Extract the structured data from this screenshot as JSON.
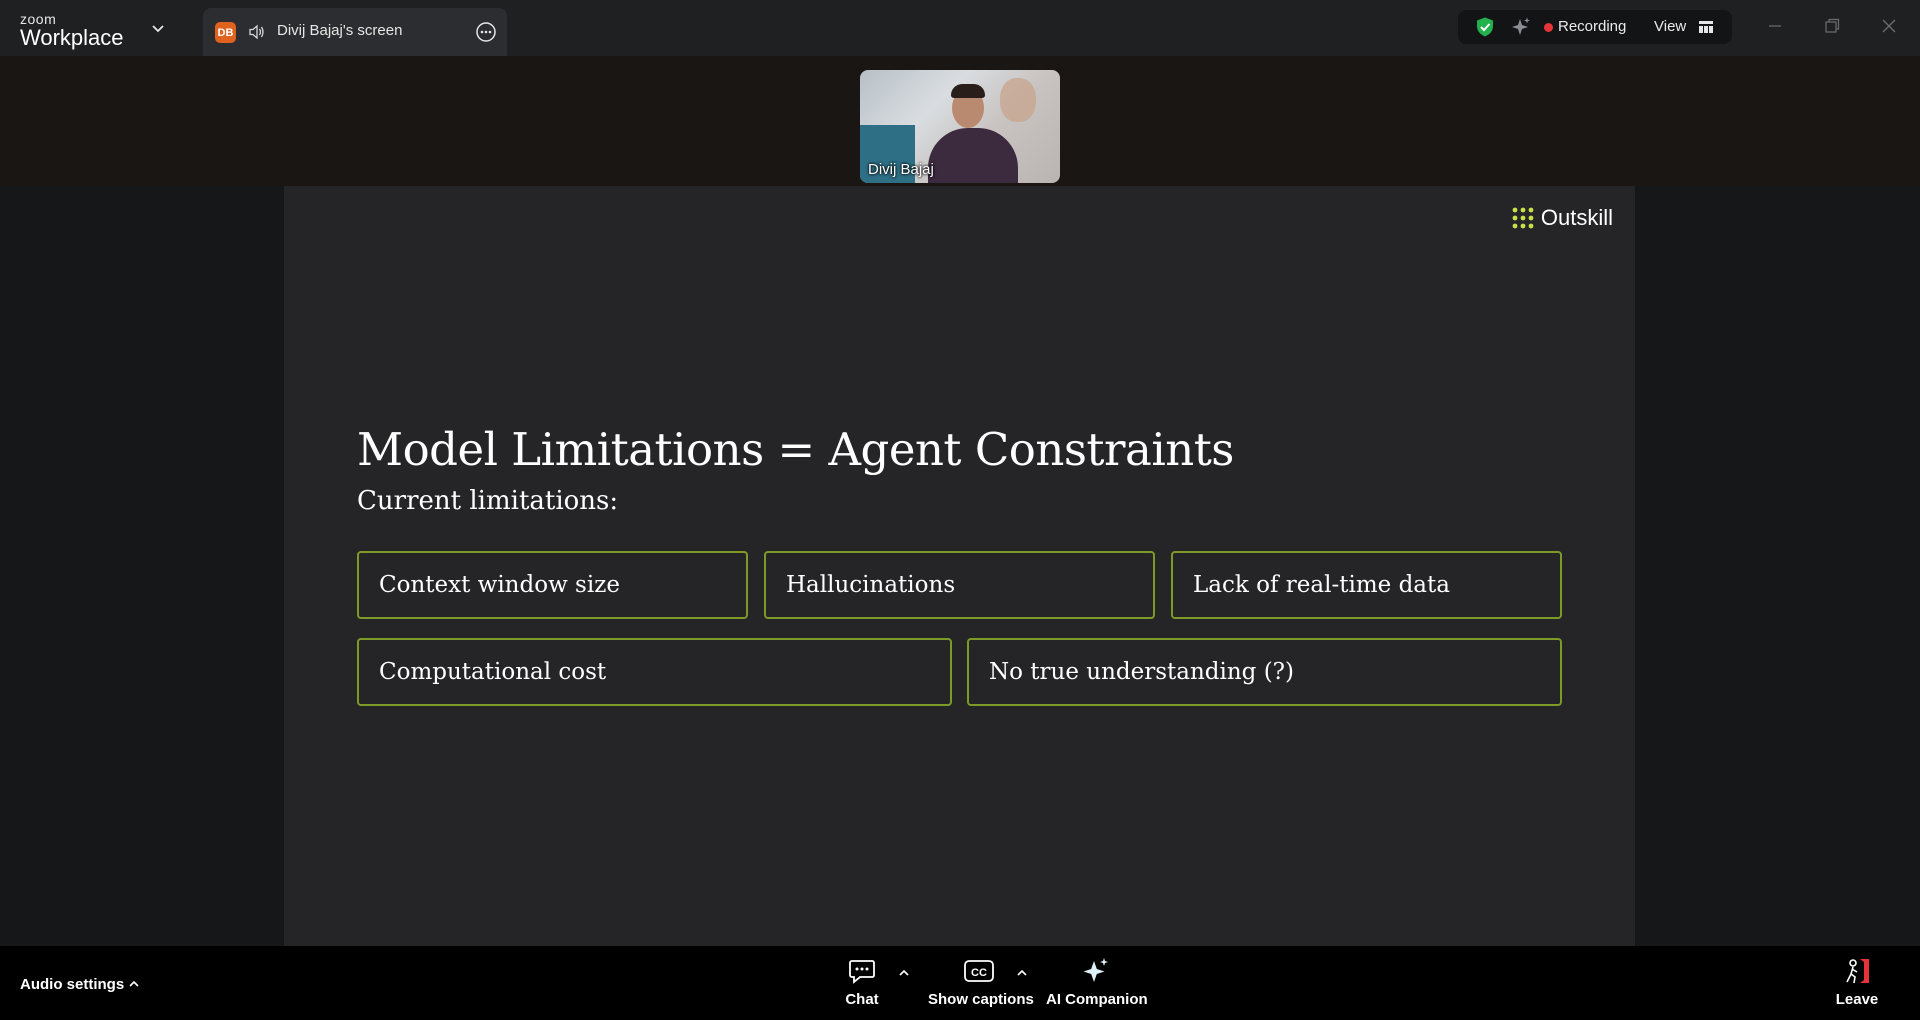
{
  "app": {
    "logo_small": "zoom",
    "logo_big": "Workplace"
  },
  "tab": {
    "avatar_initials": "DB",
    "label": "Divij Bajaj's screen"
  },
  "status": {
    "recording_label": "Recording",
    "view_label": "View",
    "recording_color": "#e5343a",
    "shield_color": "#22b14c"
  },
  "participant": {
    "name": "Divij Bajaj"
  },
  "slide": {
    "brand": "Outskill",
    "title": "Model Limitations = Agent Constraints",
    "subtitle": "Current limitations:",
    "limitations": [
      "Context window size",
      "Hallucinations",
      "Lack of real-time data",
      "Computational cost",
      "No true understanding (?)"
    ],
    "accent_color": "#7e9a26"
  },
  "toolbar": {
    "audio_settings": "Audio settings",
    "chat": "Chat",
    "captions": "Show captions",
    "ai_companion": "AI Companion",
    "leave": "Leave"
  }
}
